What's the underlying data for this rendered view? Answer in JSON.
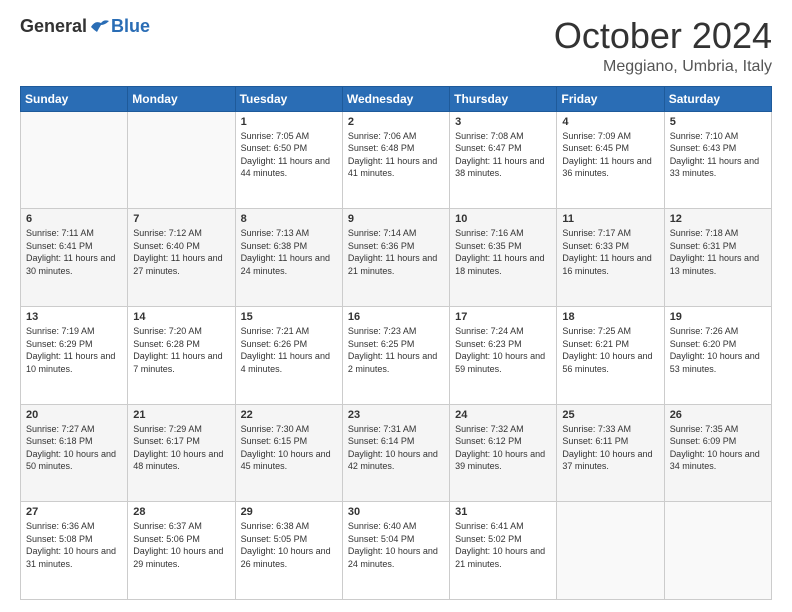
{
  "header": {
    "logo": {
      "general": "General",
      "blue": "Blue"
    },
    "title": "October 2024",
    "location": "Meggiano, Umbria, Italy"
  },
  "days_of_week": [
    "Sunday",
    "Monday",
    "Tuesday",
    "Wednesday",
    "Thursday",
    "Friday",
    "Saturday"
  ],
  "weeks": [
    [
      {
        "day": "",
        "info": ""
      },
      {
        "day": "",
        "info": ""
      },
      {
        "day": "1",
        "sunrise": "7:05 AM",
        "sunset": "6:50 PM",
        "daylight": "11 hours and 44 minutes."
      },
      {
        "day": "2",
        "sunrise": "7:06 AM",
        "sunset": "6:48 PM",
        "daylight": "11 hours and 41 minutes."
      },
      {
        "day": "3",
        "sunrise": "7:08 AM",
        "sunset": "6:47 PM",
        "daylight": "11 hours and 38 minutes."
      },
      {
        "day": "4",
        "sunrise": "7:09 AM",
        "sunset": "6:45 PM",
        "daylight": "11 hours and 36 minutes."
      },
      {
        "day": "5",
        "sunrise": "7:10 AM",
        "sunset": "6:43 PM",
        "daylight": "11 hours and 33 minutes."
      }
    ],
    [
      {
        "day": "6",
        "sunrise": "7:11 AM",
        "sunset": "6:41 PM",
        "daylight": "11 hours and 30 minutes."
      },
      {
        "day": "7",
        "sunrise": "7:12 AM",
        "sunset": "6:40 PM",
        "daylight": "11 hours and 27 minutes."
      },
      {
        "day": "8",
        "sunrise": "7:13 AM",
        "sunset": "6:38 PM",
        "daylight": "11 hours and 24 minutes."
      },
      {
        "day": "9",
        "sunrise": "7:14 AM",
        "sunset": "6:36 PM",
        "daylight": "11 hours and 21 minutes."
      },
      {
        "day": "10",
        "sunrise": "7:16 AM",
        "sunset": "6:35 PM",
        "daylight": "11 hours and 18 minutes."
      },
      {
        "day": "11",
        "sunrise": "7:17 AM",
        "sunset": "6:33 PM",
        "daylight": "11 hours and 16 minutes."
      },
      {
        "day": "12",
        "sunrise": "7:18 AM",
        "sunset": "6:31 PM",
        "daylight": "11 hours and 13 minutes."
      }
    ],
    [
      {
        "day": "13",
        "sunrise": "7:19 AM",
        "sunset": "6:29 PM",
        "daylight": "11 hours and 10 minutes."
      },
      {
        "day": "14",
        "sunrise": "7:20 AM",
        "sunset": "6:28 PM",
        "daylight": "11 hours and 7 minutes."
      },
      {
        "day": "15",
        "sunrise": "7:21 AM",
        "sunset": "6:26 PM",
        "daylight": "11 hours and 4 minutes."
      },
      {
        "day": "16",
        "sunrise": "7:23 AM",
        "sunset": "6:25 PM",
        "daylight": "11 hours and 2 minutes."
      },
      {
        "day": "17",
        "sunrise": "7:24 AM",
        "sunset": "6:23 PM",
        "daylight": "10 hours and 59 minutes."
      },
      {
        "day": "18",
        "sunrise": "7:25 AM",
        "sunset": "6:21 PM",
        "daylight": "10 hours and 56 minutes."
      },
      {
        "day": "19",
        "sunrise": "7:26 AM",
        "sunset": "6:20 PM",
        "daylight": "10 hours and 53 minutes."
      }
    ],
    [
      {
        "day": "20",
        "sunrise": "7:27 AM",
        "sunset": "6:18 PM",
        "daylight": "10 hours and 50 minutes."
      },
      {
        "day": "21",
        "sunrise": "7:29 AM",
        "sunset": "6:17 PM",
        "daylight": "10 hours and 48 minutes."
      },
      {
        "day": "22",
        "sunrise": "7:30 AM",
        "sunset": "6:15 PM",
        "daylight": "10 hours and 45 minutes."
      },
      {
        "day": "23",
        "sunrise": "7:31 AM",
        "sunset": "6:14 PM",
        "daylight": "10 hours and 42 minutes."
      },
      {
        "day": "24",
        "sunrise": "7:32 AM",
        "sunset": "6:12 PM",
        "daylight": "10 hours and 39 minutes."
      },
      {
        "day": "25",
        "sunrise": "7:33 AM",
        "sunset": "6:11 PM",
        "daylight": "10 hours and 37 minutes."
      },
      {
        "day": "26",
        "sunrise": "7:35 AM",
        "sunset": "6:09 PM",
        "daylight": "10 hours and 34 minutes."
      }
    ],
    [
      {
        "day": "27",
        "sunrise": "6:36 AM",
        "sunset": "5:08 PM",
        "daylight": "10 hours and 31 minutes."
      },
      {
        "day": "28",
        "sunrise": "6:37 AM",
        "sunset": "5:06 PM",
        "daylight": "10 hours and 29 minutes."
      },
      {
        "day": "29",
        "sunrise": "6:38 AM",
        "sunset": "5:05 PM",
        "daylight": "10 hours and 26 minutes."
      },
      {
        "day": "30",
        "sunrise": "6:40 AM",
        "sunset": "5:04 PM",
        "daylight": "10 hours and 24 minutes."
      },
      {
        "day": "31",
        "sunrise": "6:41 AM",
        "sunset": "5:02 PM",
        "daylight": "10 hours and 21 minutes."
      },
      {
        "day": "",
        "info": ""
      },
      {
        "day": "",
        "info": ""
      }
    ]
  ],
  "labels": {
    "sunrise": "Sunrise:",
    "sunset": "Sunset:",
    "daylight": "Daylight:"
  }
}
